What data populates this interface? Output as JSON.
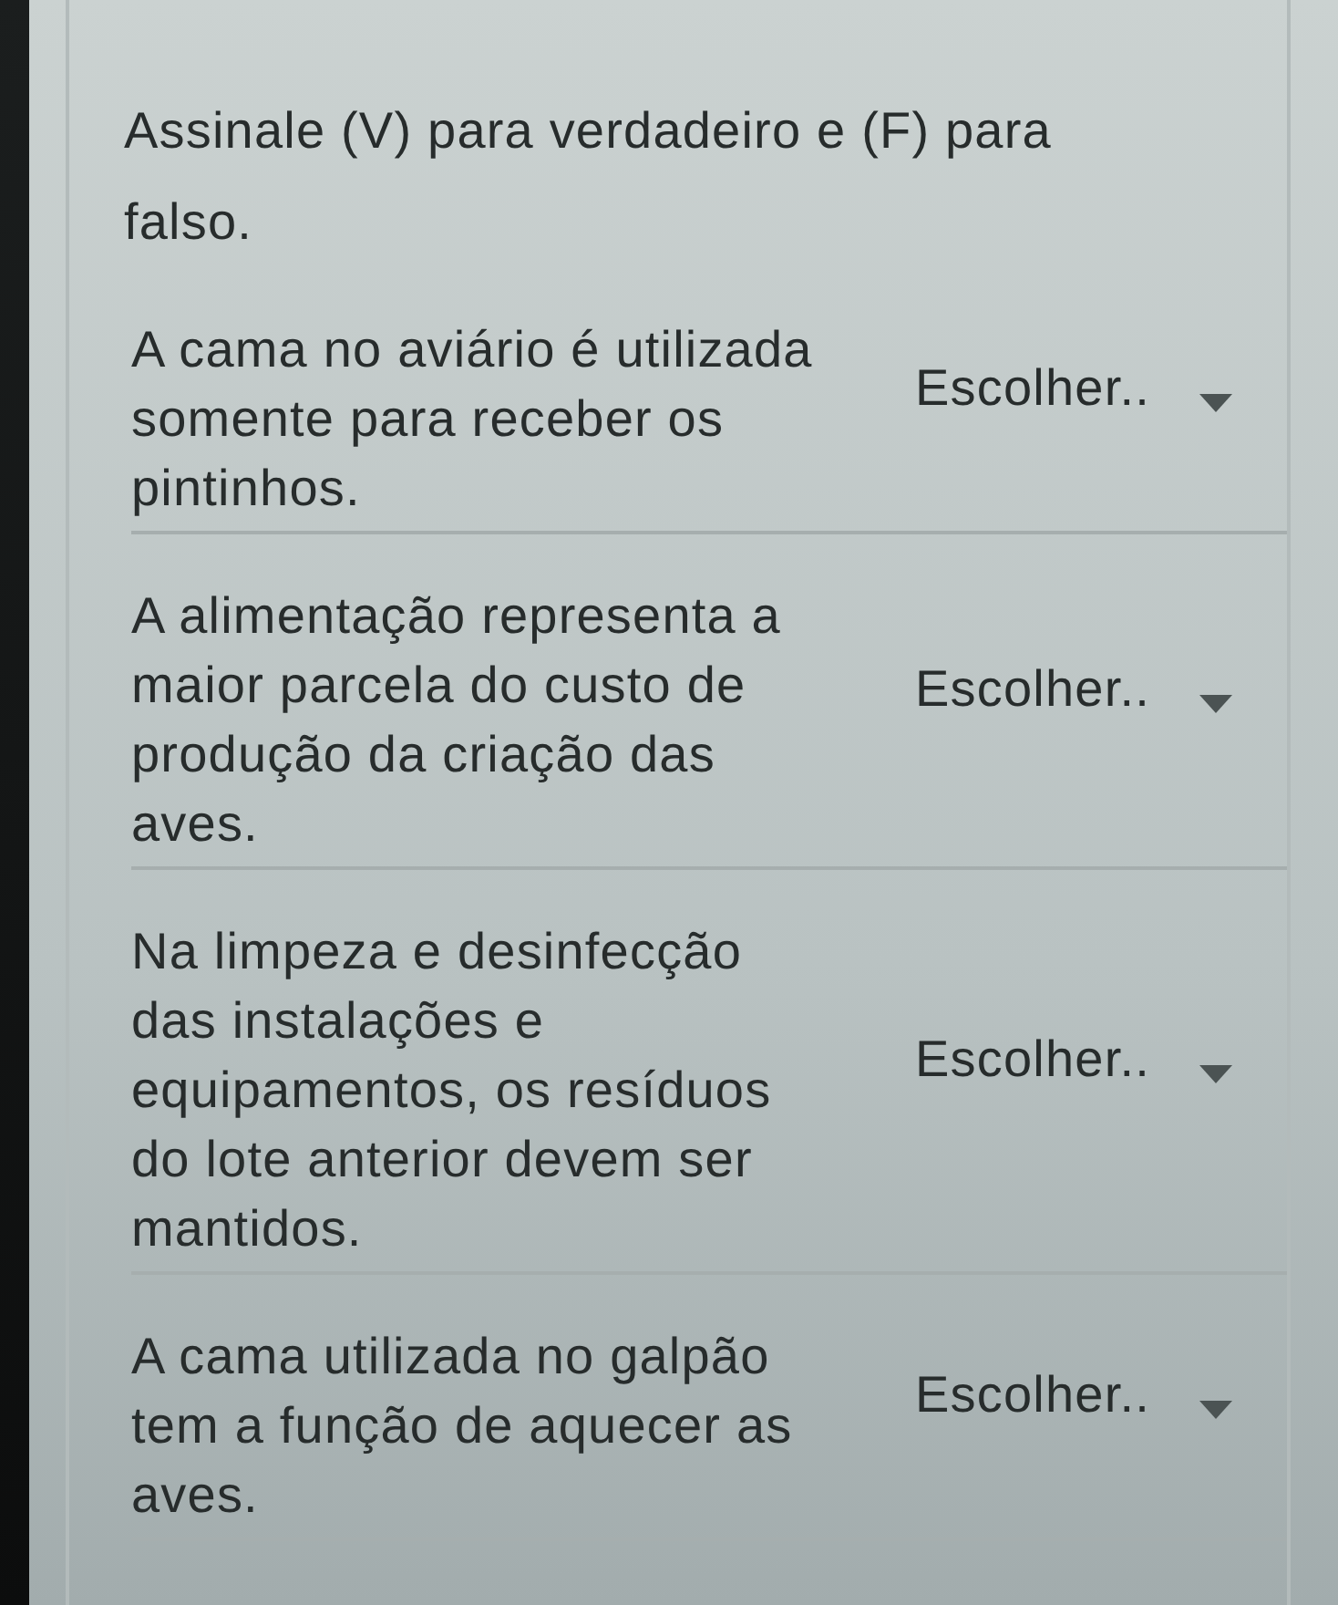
{
  "instruction": "Assinale (V) para verdadeiro e (F) para falso.",
  "questions": [
    {
      "statement": "A cama no aviário é utilizada\nsomente para receber os\npintinhos.",
      "dropdown": {
        "value": "Escolher.."
      }
    },
    {
      "statement": "A alimentação representa a\nmaior parcela do custo de\nprodução da criação das\naves.",
      "dropdown": {
        "value": "Escolher.."
      }
    },
    {
      "statement": "Na limpeza e desinfecção\ndas instalações e\nequipamentos, os resíduos\ndo lote anterior devem ser\nmantidos.",
      "dropdown": {
        "value": "Escolher.."
      }
    },
    {
      "statement": "A cama utilizada no galpão\ntem a função de aquecer as\naves.",
      "dropdown": {
        "value": "Escolher.."
      }
    }
  ]
}
